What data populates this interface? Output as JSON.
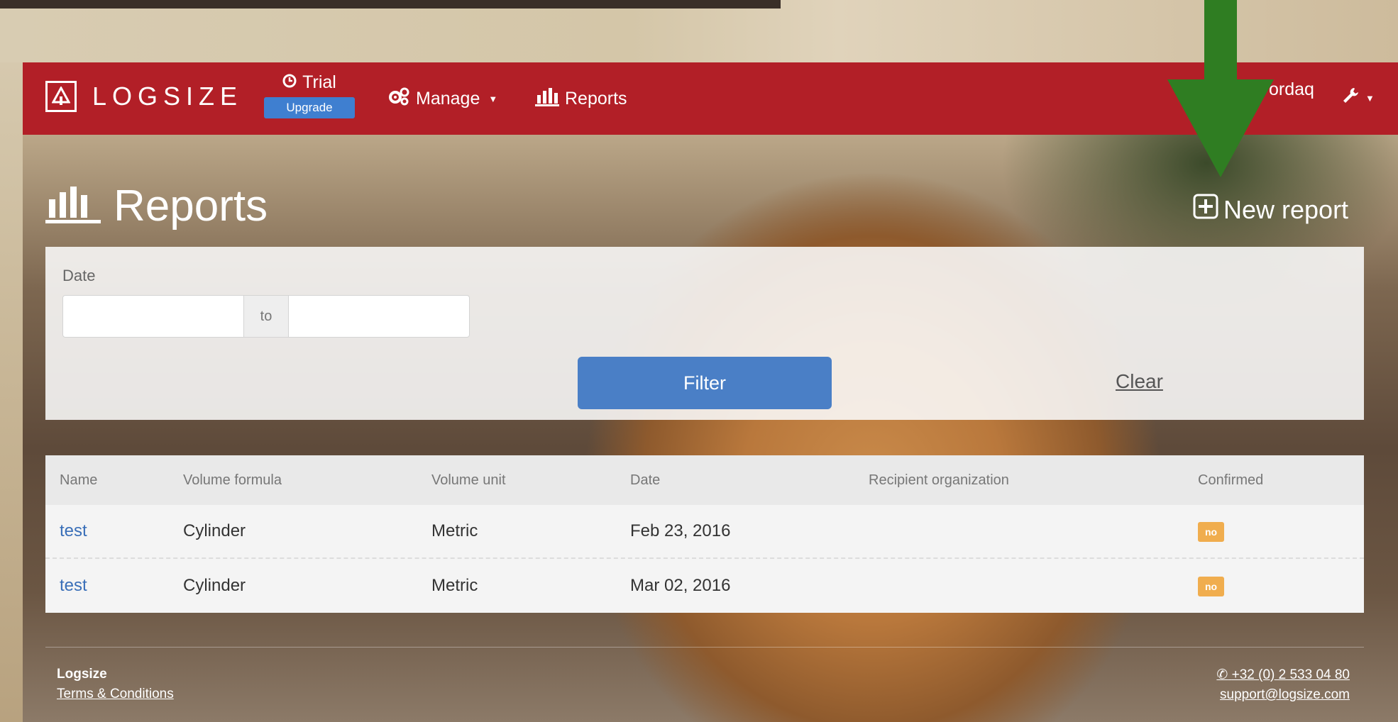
{
  "navbar": {
    "logo_text": "LOGSIZE",
    "trial_label": "Trial",
    "upgrade_label": "Upgrade",
    "manage_label": "Manage",
    "reports_label": "Reports",
    "user_label": "ordaq"
  },
  "page": {
    "title": "Reports",
    "new_report_label": "New report"
  },
  "filter": {
    "date_label": "Date",
    "from_value": "",
    "to_separator": "to",
    "to_value": "",
    "filter_button": "Filter",
    "clear_link": "Clear"
  },
  "table": {
    "columns": [
      "Name",
      "Volume formula",
      "Volume unit",
      "Date",
      "Recipient organization",
      "Confirmed"
    ],
    "rows": [
      {
        "name": "test",
        "formula": "Cylinder",
        "unit": "Metric",
        "date": "Feb 23, 2016",
        "recipient": "",
        "confirmed": "no"
      },
      {
        "name": "test",
        "formula": "Cylinder",
        "unit": "Metric",
        "date": "Mar 02, 2016",
        "recipient": "",
        "confirmed": "no"
      }
    ]
  },
  "footer": {
    "brand": "Logsize",
    "terms": "Terms & Conditions",
    "phone": "+32 (0) 2 533 04 80",
    "email": "support@logsize.com"
  },
  "colors": {
    "navbar": "#b21f27",
    "primary_button": "#4a7fc6",
    "badge": "#f0ad4e",
    "annotation_arrow": "#2f7d22"
  },
  "icons": [
    "logo-tree-icon",
    "clock-icon",
    "gears-icon",
    "bar-chart-icon",
    "wrench-icon",
    "plus-square-icon",
    "phone-icon",
    "down-arrow-annotation"
  ]
}
